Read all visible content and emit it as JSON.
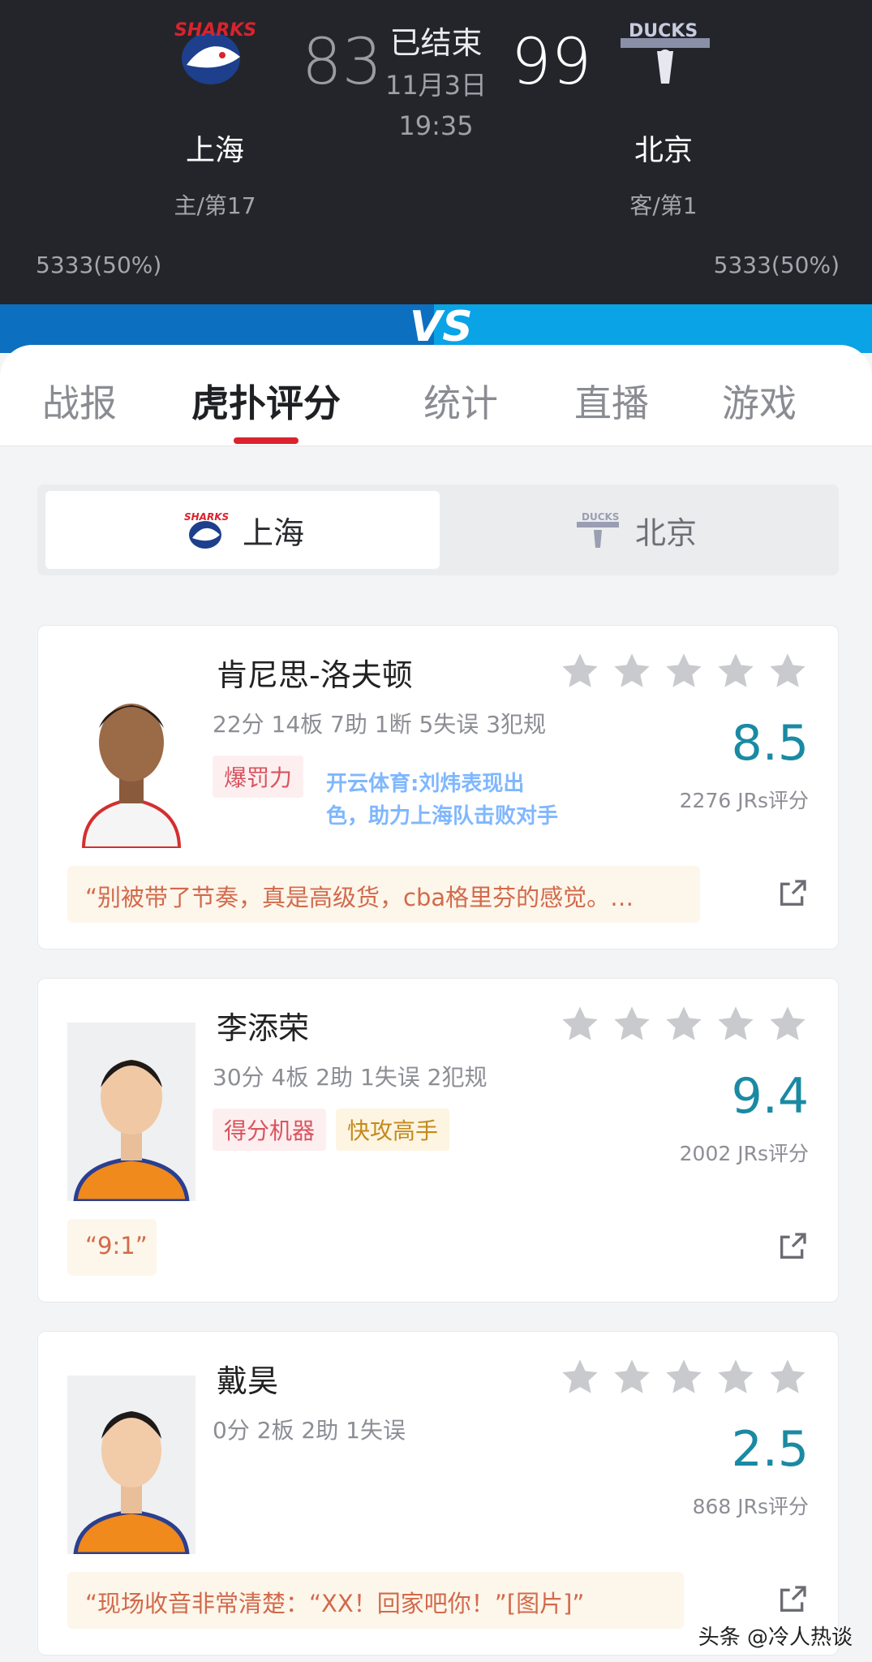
{
  "header": {
    "status": "已结束",
    "date": "11月3日",
    "time": "19:35",
    "home": {
      "name": "上海",
      "score": "83",
      "rank": "主/第17",
      "support": "5333(50%)",
      "logo_text": "SHARKS"
    },
    "away": {
      "name": "北京",
      "score": "99",
      "rank": "客/第1",
      "support": "5333(50%)",
      "logo_text": "DUCKS"
    },
    "vs": "VS"
  },
  "tabs": [
    "战报",
    "虎扑评分",
    "统计",
    "直播",
    "游戏"
  ],
  "active_tab": "虎扑评分",
  "team_switch": {
    "home": "上海",
    "away": "北京",
    "active": "上海"
  },
  "players": [
    {
      "name": "肯尼思-洛夫顿",
      "stats": "22分 14板 7助 1断 5失误 3犯规",
      "tags": [
        {
          "label": "爆罚力",
          "color": "red"
        }
      ],
      "rating": "8.5",
      "rating_count": "2276 JRs评分",
      "stars_filled": 0,
      "comment": "“别被带了节奏，真是高级货，cba格里芬的感觉。…"
    },
    {
      "name": "李添荣",
      "stats": "30分 4板 2助 1失误 2犯规",
      "tags": [
        {
          "label": "得分机器",
          "color": "red"
        },
        {
          "label": "快攻高手",
          "color": "yellow"
        }
      ],
      "rating": "9.4",
      "rating_count": "2002 JRs评分",
      "stars_filled": 0,
      "comment": "“9:1”"
    },
    {
      "name": "戴昊",
      "stats": "0分 2板 2助 1失误",
      "tags": [],
      "rating": "2.5",
      "rating_count": "868 JRs评分",
      "stars_filled": 0,
      "comment": "“现场收音非常清楚：“XX！回家吧你！”[图片]”"
    }
  ],
  "watermark": "开云体育:刘炜表现出色，助力上海队击败对手",
  "footer": "头条 @冷人热谈",
  "colors": {
    "accent_red": "#d9232e",
    "rating_teal": "#1a8aa3",
    "header_bg": "#23252b",
    "vs_blue": "#0aa3e6"
  }
}
